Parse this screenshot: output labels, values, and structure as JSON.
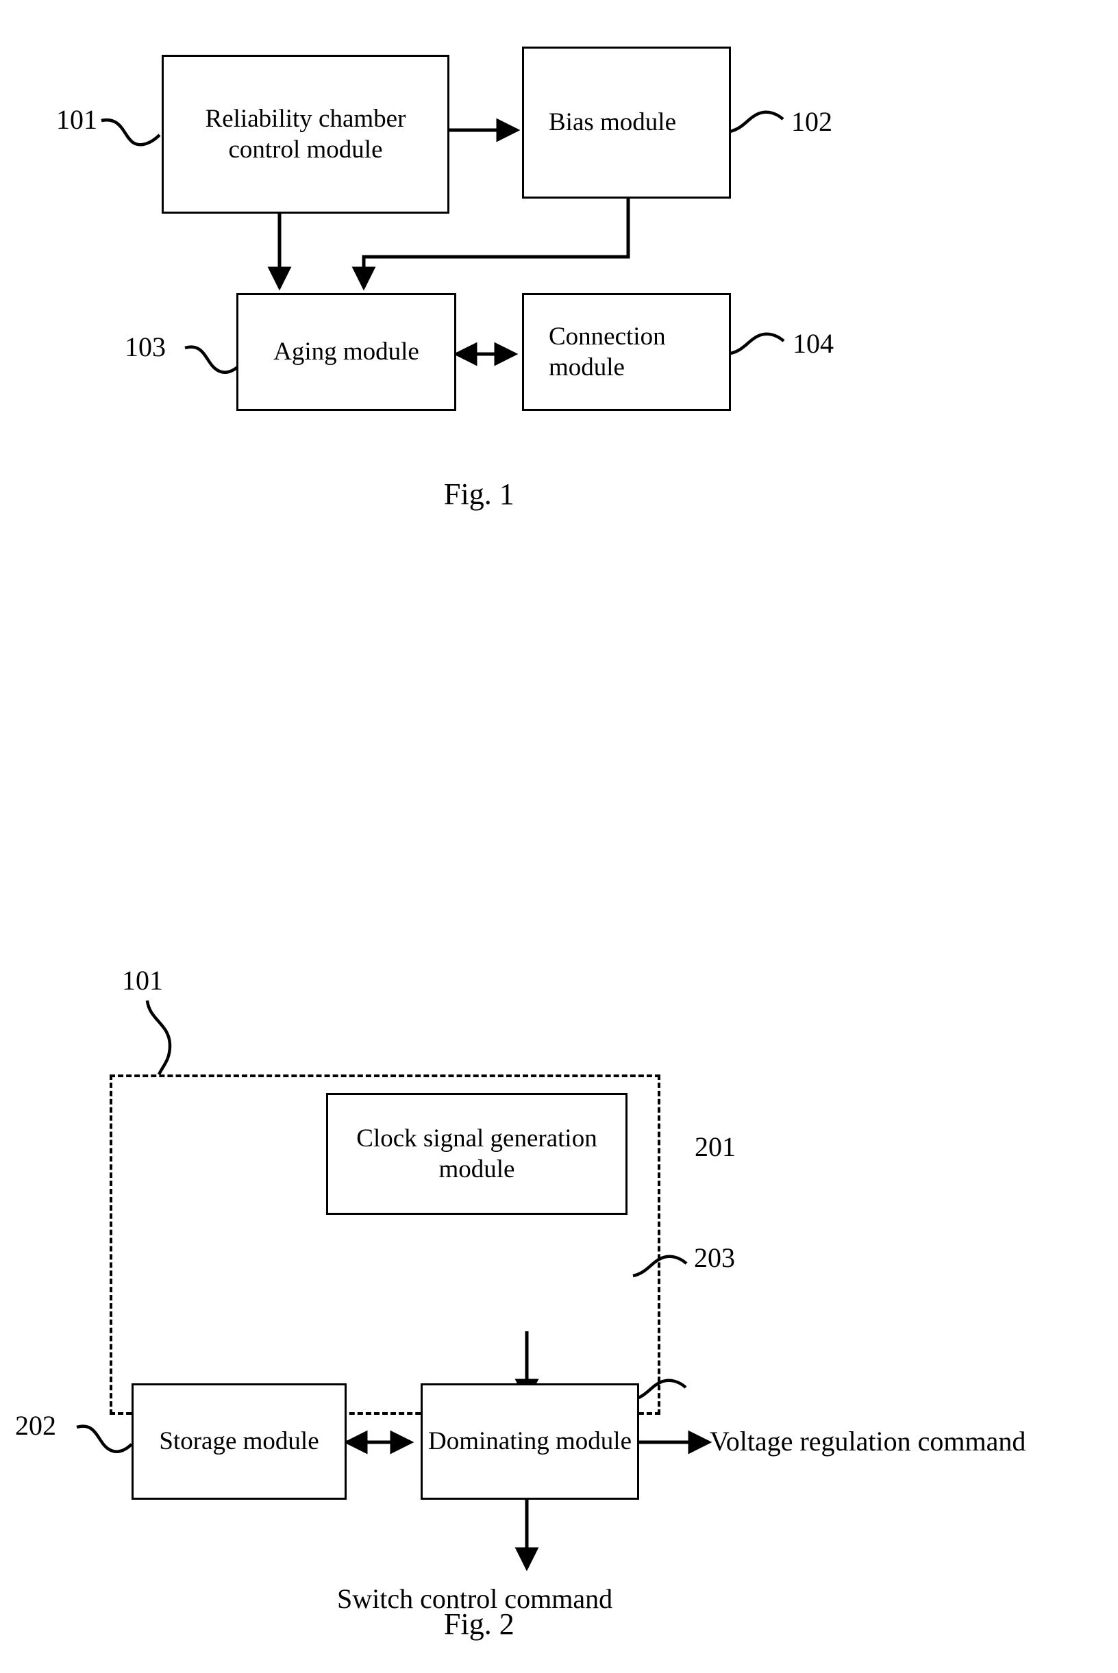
{
  "figures": [
    {
      "caption": "Fig. 1",
      "boxes": [
        {
          "id": "reliability_chamber_control_module",
          "label": "Reliability chamber control module",
          "ref": "101"
        },
        {
          "id": "bias_module",
          "label": "Bias module",
          "ref": "102"
        },
        {
          "id": "aging_module",
          "label": "Aging module",
          "ref": "103"
        },
        {
          "id": "connection_module",
          "label": "Connection module",
          "ref": "104"
        }
      ],
      "connections": [
        {
          "from": "reliability_chamber_control_module",
          "to": "bias_module",
          "type": "arrow"
        },
        {
          "from": "reliability_chamber_control_module",
          "to": "aging_module",
          "type": "arrow"
        },
        {
          "from": "bias_module",
          "to": "aging_module",
          "type": "arrow"
        },
        {
          "from": "aging_module",
          "to": "connection_module",
          "type": "double-arrow"
        }
      ]
    },
    {
      "caption": "Fig. 2",
      "container_ref": "101",
      "boxes": [
        {
          "id": "clock_signal_generation_module",
          "label": "Clock signal generation module",
          "ref": "201"
        },
        {
          "id": "storage_module",
          "label": "Storage module",
          "ref": "202"
        },
        {
          "id": "dominating_module",
          "label": "Dominating module",
          "ref": "203"
        }
      ],
      "outputs": [
        {
          "id": "voltage_regulation_command",
          "label": "Voltage regulation command"
        },
        {
          "id": "switch_control_command",
          "label": "Switch control command"
        }
      ],
      "connections": [
        {
          "from": "clock_signal_generation_module",
          "to": "dominating_module",
          "type": "arrow"
        },
        {
          "from": "storage_module",
          "to": "dominating_module",
          "type": "double-arrow"
        },
        {
          "from": "dominating_module",
          "to": "voltage_regulation_command",
          "type": "arrow"
        },
        {
          "from": "dominating_module",
          "to": "switch_control_command",
          "type": "arrow"
        }
      ]
    }
  ],
  "fig1": {
    "caption": "Fig. 1",
    "box_reliability": "Reliability chamber control module",
    "box_bias": "Bias module",
    "box_aging": "Aging module",
    "box_connection": "Connection module",
    "ref_101": "101",
    "ref_102": "102",
    "ref_103": "103",
    "ref_104": "104"
  },
  "fig2": {
    "caption": "Fig. 2",
    "box_clock": "Clock signal generation module",
    "box_storage": "Storage module",
    "box_dominating": "Dominating module",
    "ref_101": "101",
    "ref_201": "201",
    "ref_202": "202",
    "ref_203": "203",
    "out_voltage": "Voltage regulation command",
    "out_switch": "Switch control command"
  },
  "colors": {
    "ink": "#000000",
    "paper": "#ffffff"
  }
}
